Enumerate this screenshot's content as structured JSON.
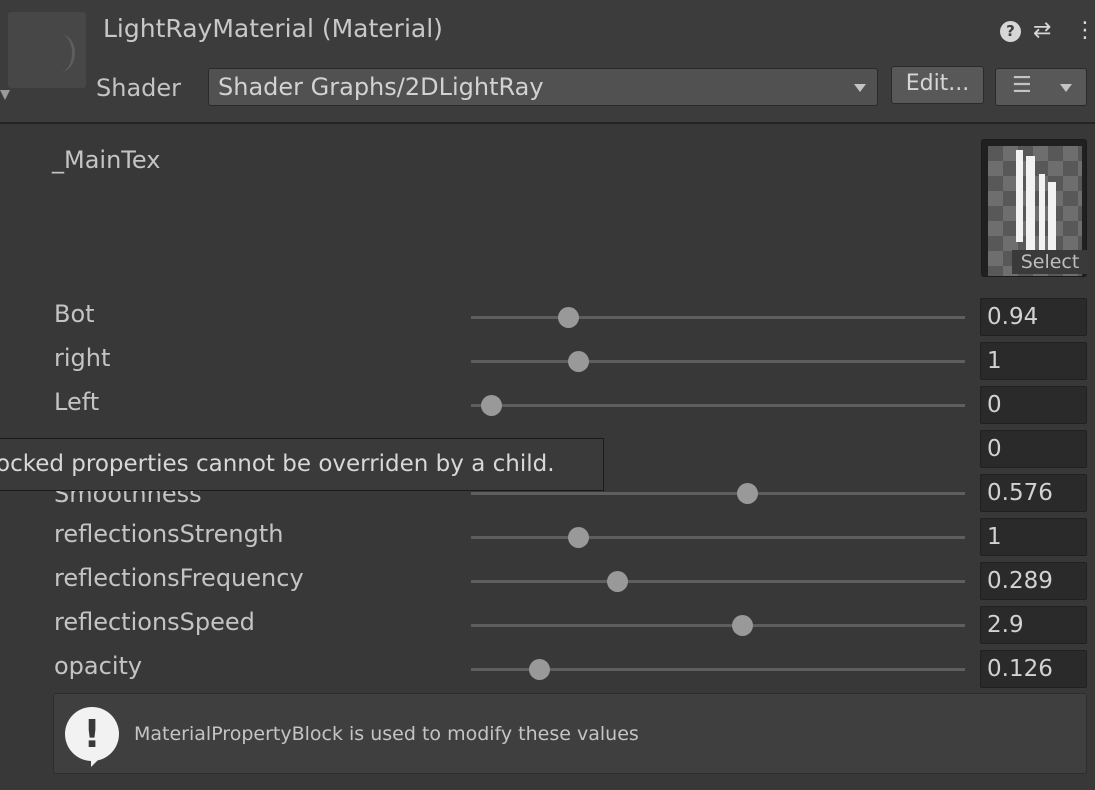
{
  "header": {
    "title": "LightRayMaterial (Material)",
    "help_icon": "?",
    "preset_icon": "⇄",
    "more_icon": "⋮",
    "shader_label": "Shader",
    "shader_value": "Shader Graphs/2DLightRay",
    "edit_button": "Edit...",
    "list_icon": "☰"
  },
  "texture": {
    "label": "_MainTex",
    "select_label": "Select"
  },
  "properties": [
    {
      "label": "Bot",
      "value": "0.94",
      "slider_fraction": 0.18
    },
    {
      "label": "right",
      "value": "1",
      "slider_fraction": 0.2
    },
    {
      "label": "Left",
      "value": "0",
      "slider_fraction": 0.02
    },
    {
      "label": "",
      "value": "0",
      "slider_fraction": null
    },
    {
      "label": "Smoothness",
      "value": "0.576",
      "slider_fraction": 0.55
    },
    {
      "label": "reflectionsStrength",
      "value": "1",
      "slider_fraction": 0.2
    },
    {
      "label": "reflectionsFrequency",
      "value": "0.289",
      "slider_fraction": 0.28
    },
    {
      "label": "reflectionsSpeed",
      "value": "2.9",
      "slider_fraction": 0.54
    },
    {
      "label": "opacity",
      "value": "0.126",
      "slider_fraction": 0.12
    }
  ],
  "tooltip": {
    "text": "ocked properties cannot be overriden by a child."
  },
  "helpbox": {
    "icon": "!",
    "text": "MaterialPropertyBlock is used to modify these values"
  },
  "colors": {
    "background": "#383838",
    "header": "#3c3c3c",
    "field": "#2a2a2a",
    "knob": "#999999"
  }
}
